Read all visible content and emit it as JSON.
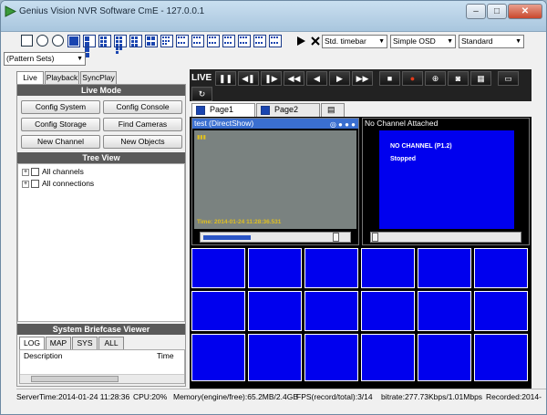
{
  "window": {
    "title": "Genius Vision NVR Software CmE - 127.0.0.1"
  },
  "toolbar": {
    "timebar": "Std. timebar",
    "osd": "Simple OSD",
    "mode": "Standard",
    "pattern": "(Pattern Sets)"
  },
  "tabs": [
    "Live",
    "Playback",
    "SyncPlay"
  ],
  "live_mode": {
    "title": "Live Mode",
    "buttons": [
      "Config System",
      "Config Console",
      "Config Storage",
      "Find Cameras",
      "New Channel",
      "New Objects"
    ]
  },
  "tree_view": {
    "title": "Tree View",
    "items": [
      "All channels",
      "All connections"
    ]
  },
  "briefcase": {
    "title": "System Briefcase Viewer",
    "tabs": [
      "LOG",
      "MAP",
      "SYS",
      "ALL"
    ],
    "columns": [
      "Description",
      "Time"
    ]
  },
  "controls": {
    "live": "LIVE"
  },
  "pages": [
    "Page1",
    "Page2"
  ],
  "cameras": {
    "cam1": {
      "title": "test (DirectShow)",
      "timestamp": "Time: 2014-01-24 11:28:36.531"
    },
    "cam2": {
      "title": "No Channel Attached",
      "line1": "NO CHANNEL (P1.2)",
      "line2": "Stopped"
    }
  },
  "status": {
    "server_time": "ServerTime:2014-01-24 11:28:36",
    "cpu": "CPU:20%",
    "memory": "Memory(engine/free):65.2MB/2.4GB",
    "fps": "FPS(record/total):3/14",
    "bitrate": "bitrate:277.73Kbps/1.01Mbps",
    "recorded": "Recorded:2014-"
  },
  "colors": {
    "accent": "#0000ee",
    "header": "#5a5a5a",
    "titlebar": "#a9c6de"
  }
}
